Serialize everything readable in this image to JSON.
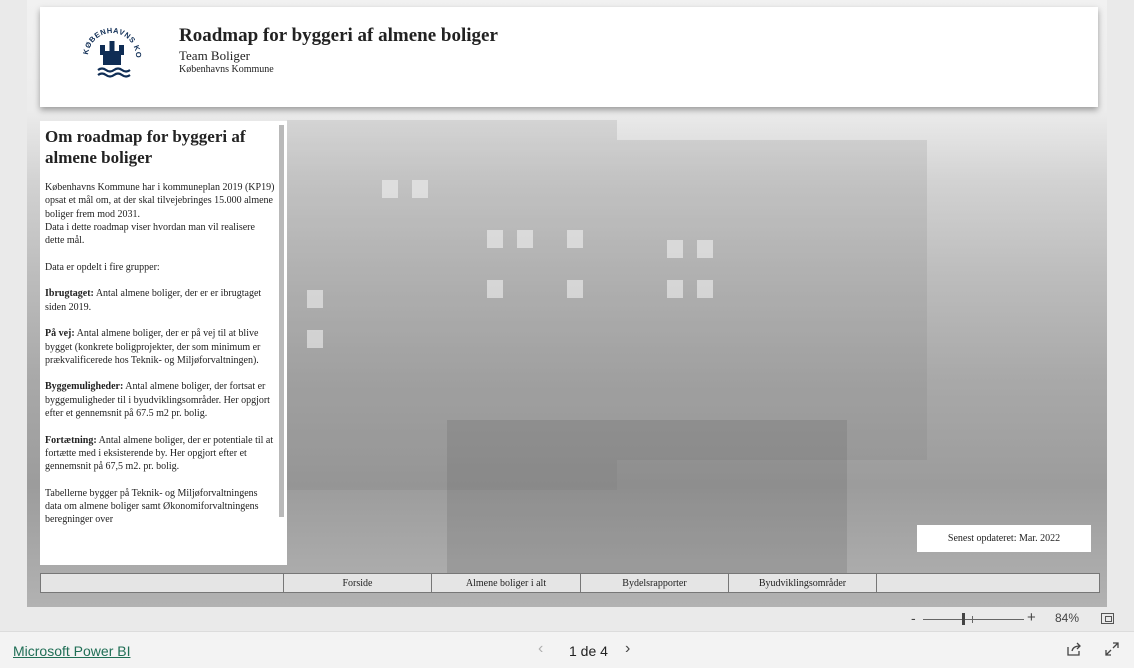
{
  "header": {
    "title": "Roadmap for byggeri af almene boliger",
    "subtitle1": "Team Boliger",
    "subtitle2": "Københavns Kommune",
    "logo_text": "KØBENHAVNS KOMMUNE"
  },
  "info": {
    "heading": "Om roadmap for byggeri af almene boliger",
    "intro": "Københavns Kommune har i kommuneplan 2019 (KP19) opsat et mål om, at der skal tilvejebringes 15.000  almene boliger frem mod 2031.",
    "intro2": "Data i dette roadmap viser hvordan man vil realisere dette mål.",
    "groups_intro": "Data er opdelt i fire grupper:",
    "items": [
      {
        "term": "Ibrugtaget:",
        "text": " Antal almene boliger, der er er ibrugtaget siden 2019."
      },
      {
        "term": "På vej:",
        "text": " Antal almene boliger, der er på vej til at blive bygget (konkrete boligprojekter, der som minimum er prækvalificerede hos Teknik- og Miljøforvaltningen)."
      },
      {
        "term": "Byggemuligheder:",
        "text": " Antal almene boliger, der fortsat er byggemuligheder til i byudviklingsområder. Her opgjort efter et gennemsnit på 67.5 m2 pr. bolig."
      },
      {
        "term": "Fortætning:",
        "text": " Antal almene boliger, der er potentiale til at fortætte med i eksisterende by. Her opgjort efter et gennemsnit på 67,5 m2. pr. bolig."
      }
    ],
    "closing": "Tabellerne bygger på Teknik- og Miljøforvaltningens data om almene boliger samt Økonomiforvaltningens beregninger over"
  },
  "updated": "Senest opdateret: Mar. 2022",
  "nav": {
    "tabs": [
      "",
      "Forside",
      "Almene boliger i alt",
      "Bydelsrapporter",
      "Byudviklingsområder",
      ""
    ]
  },
  "zoom": {
    "minus": "-",
    "plus": "+",
    "level": "84%"
  },
  "footer": {
    "brand": "Microsoft Power BI",
    "page": "1 de 4",
    "prev": "‹",
    "next": "›"
  }
}
